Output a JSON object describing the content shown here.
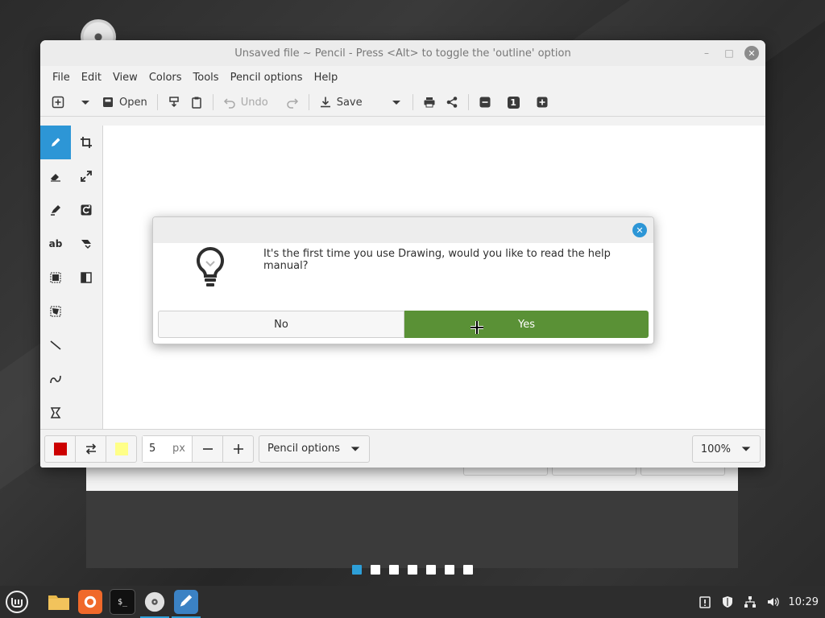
{
  "window": {
    "title": "Unsaved file ~ Pencil - Press <Alt> to toggle the 'outline' option"
  },
  "menu": [
    "File",
    "Edit",
    "View",
    "Colors",
    "Tools",
    "Pencil options",
    "Help"
  ],
  "toolbar": {
    "open_label": "Open",
    "undo_label": "Undo",
    "save_label": "Save",
    "zoom_reset_label": "1"
  },
  "tools": [
    {
      "name": "pencil-tool",
      "icon": "pencil-icon",
      "active": true
    },
    {
      "name": "crop-tool",
      "icon": "crop-icon"
    },
    {
      "name": "eraser-tool",
      "icon": "eraser-icon"
    },
    {
      "name": "scale-tool",
      "icon": "scale-icon"
    },
    {
      "name": "highlighter-tool",
      "icon": "highlighter-icon"
    },
    {
      "name": "rotate-tool",
      "icon": "rotate-icon"
    },
    {
      "name": "text-tool",
      "icon": "text-icon"
    },
    {
      "name": "skew-tool",
      "icon": "skew-icon"
    },
    {
      "name": "rect-selection-tool",
      "icon": "rect-select-icon"
    },
    {
      "name": "filters-tool",
      "icon": "filters-icon"
    },
    {
      "name": "free-selection-tool",
      "icon": "free-select-icon"
    },
    {
      "name": "line-tool",
      "icon": "line-icon"
    },
    {
      "name": "curve-tool",
      "icon": "curve-icon"
    },
    {
      "name": "shape-tool",
      "icon": "shape-icon"
    }
  ],
  "bottombar": {
    "main_color": "#cc0000",
    "secondary_color": "#ffff88",
    "size_value": "5",
    "size_unit": "px",
    "options_label": "Pencil options",
    "zoom_label": "100%"
  },
  "dialog": {
    "message": "It's the first time you use Drawing, would you like to read the help manual?",
    "no_label": "No",
    "yes_label": "Yes",
    "yes_color": "#5a9136"
  },
  "slideshow": {
    "dots": 7,
    "active_index": 0,
    "accent": "#2d9fd8"
  },
  "taskbar": {
    "clock": "10:29"
  }
}
